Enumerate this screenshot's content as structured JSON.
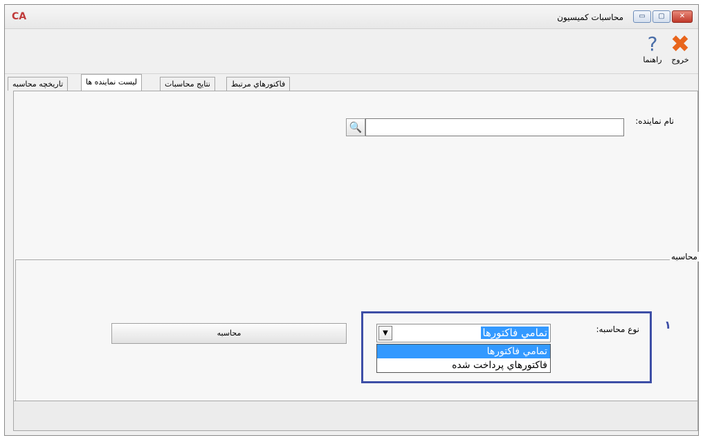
{
  "window": {
    "app_logo": "CA",
    "title": "محاسبات كميسيون",
    "close_glyph": "✕",
    "max_glyph": "▢",
    "min_glyph": "▭"
  },
  "toolbar": {
    "exit_label": "خروج",
    "help_label": "راهنما"
  },
  "tabs": [
    {
      "label": "تاريخچه محاسبه"
    },
    {
      "label": "ليست نماينده ها",
      "active": true
    },
    {
      "label": "نتايج محاسبات"
    },
    {
      "label": "فاكتورهاي مرتبط"
    }
  ],
  "form": {
    "name_label": "نام نماينده:",
    "name_value": ""
  },
  "calc": {
    "group_legend": "محاسبه",
    "step_number": "١",
    "type_label": "نوع محاسبه:",
    "type_value": "تمامي فاكتورها",
    "options": [
      "تمامي فاكتورها",
      "فاكتورهاي پرداخت شده"
    ],
    "button_label": "محاسبه"
  },
  "colors": {
    "highlight": "#3d4ea6",
    "selection": "#3399ff"
  }
}
